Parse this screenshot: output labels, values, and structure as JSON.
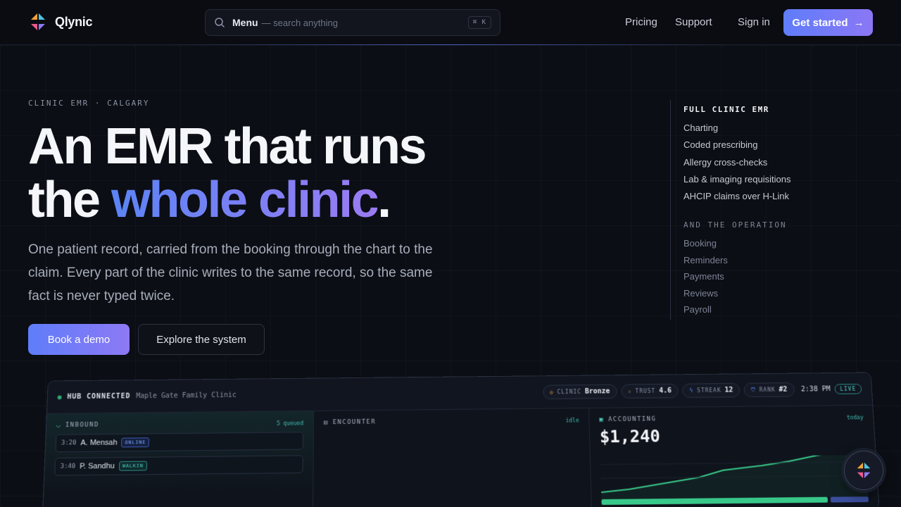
{
  "nav": {
    "brand": "Qlynic",
    "search": {
      "label": "Menu",
      "placeholder": "— search anything",
      "shortcut": "⌘ K"
    },
    "links": [
      "Pricing",
      "Support"
    ],
    "sign_in": "Sign in",
    "cta": "Get started",
    "cta_arrow": "→"
  },
  "hero": {
    "eyebrow": "CLINIC EMR · CALGARY",
    "headline_line1": "An EMR that runs",
    "headline_pre": "the ",
    "headline_accent": "whole clinic",
    "headline_post": ".",
    "subtext": "One patient record, carried from the booking through the chart to the claim. Every part of the clinic writes to the same record, so the same fact is never typed twice.",
    "primary_button": "Book a demo",
    "secondary_button": "Explore the system"
  },
  "features": {
    "heading": "FULL CLINIC EMR",
    "items": [
      "Charting",
      "Coded prescribing",
      "Allergy cross-checks",
      "Lab & imaging requisitions",
      "AHCIP claims over H-Link"
    ],
    "ops_heading": "AND THE OPERATION",
    "ops_items": [
      "Booking",
      "Reminders",
      "Payments",
      "Reviews",
      "Payroll"
    ]
  },
  "dashboard": {
    "status": "HUB CONNECTED",
    "clinic": "Maple Gate Family Clinic",
    "pills": [
      {
        "label": "CLINIC",
        "value": "Bronze"
      },
      {
        "label": "TRUST",
        "value": "4.6"
      },
      {
        "label": "STREAK",
        "value": "12"
      },
      {
        "label": "RANK",
        "value": "#2"
      }
    ],
    "time": "2:38 PM",
    "live": "LIVE",
    "inbound": {
      "title": "INBOUND",
      "meta": "5 queued",
      "rows": [
        {
          "time": "3:20",
          "name": "A. Mensah",
          "tag": "ONLINE"
        },
        {
          "time": "3:40",
          "name": "P. Sandhu",
          "tag": "WALKIN"
        }
      ]
    },
    "encounter": {
      "title": "ENCOUNTER",
      "meta": "idle"
    },
    "accounting": {
      "title": "ACCOUNTING",
      "meta": "today",
      "amount": "$1,240"
    }
  },
  "colors": {
    "accent_start": "#5f7dfa",
    "accent_end": "#8d79f4",
    "teal": "#4fd1c5",
    "green": "#38c98a"
  }
}
